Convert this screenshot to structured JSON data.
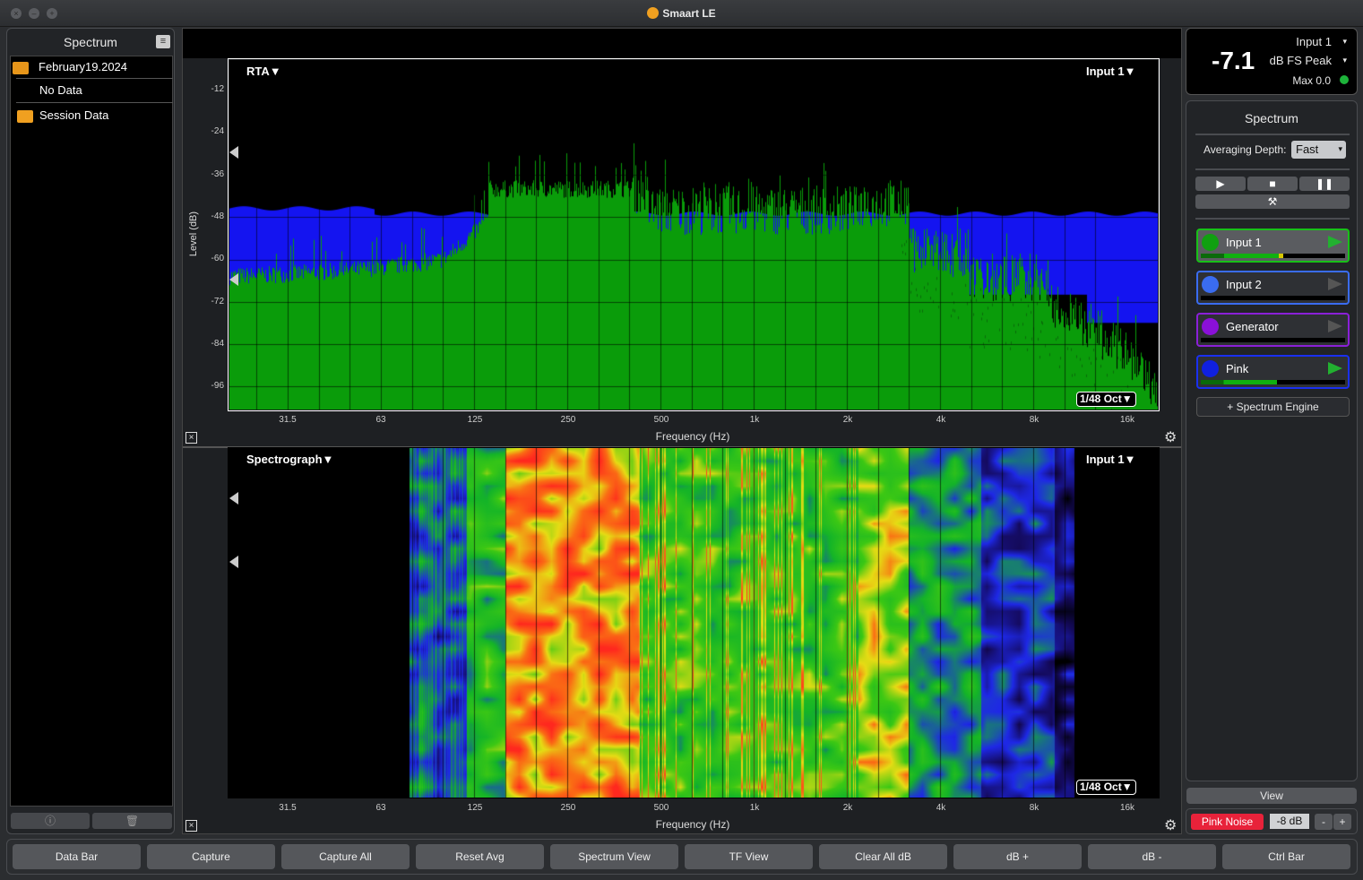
{
  "window": {
    "title": "Smaart LE"
  },
  "left_panel": {
    "title": "Spectrum",
    "items": [
      {
        "label": "February19.2024",
        "type": "folder-open"
      },
      {
        "label": "No Data",
        "type": "item"
      },
      {
        "label": "Session Data",
        "type": "folder"
      }
    ]
  },
  "rta": {
    "title": "RTA▼",
    "input": "Input 1▼",
    "resolution": "1/48 Oct▼",
    "ylabel": "Level (dB)",
    "xlabel": "Frequency (Hz)",
    "yticks": [
      "-12",
      "-24",
      "-36",
      "-48",
      "-60",
      "-72",
      "-84",
      "-96"
    ],
    "xticks": [
      "31.5",
      "63",
      "125",
      "250",
      "500",
      "1k",
      "2k",
      "4k",
      "8k",
      "16k"
    ]
  },
  "spectrograph": {
    "title": "Spectrograph▼",
    "input": "Input 1▼",
    "resolution": "1/48 Oct▼",
    "xlabel": "Frequency (Hz)",
    "xticks": [
      "31.5",
      "63",
      "125",
      "250",
      "500",
      "1k",
      "2k",
      "4k",
      "8k",
      "16k"
    ]
  },
  "meter": {
    "value": "-7.1",
    "source": "Input 1",
    "mode": "dB FS Peak",
    "max": "Max 0.0",
    "status_color": "#1db33a"
  },
  "spectrum_panel": {
    "title": "Spectrum",
    "averaging_label": "Averaging Depth:",
    "averaging_value": "Fast",
    "engines": [
      {
        "name": "Input 1",
        "color": "#10a010",
        "border": "#18c018",
        "active": true,
        "level": 0.72
      },
      {
        "name": "Input 2",
        "color": "#3a6cf0",
        "border": "#3a6cf0",
        "active": false,
        "level": 0
      },
      {
        "name": "Generator",
        "color": "#8a10d8",
        "border": "#8a20d8",
        "active": false,
        "level": 0
      },
      {
        "name": "Pink",
        "color": "#1020e0",
        "border": "#1a30f0",
        "active": true,
        "level": 0.7
      }
    ],
    "add_engine": "+ Spectrum Engine"
  },
  "view_button": "View",
  "generator": {
    "label": "Pink Noise",
    "level": "-8 dB",
    "minus": "-",
    "plus": "+",
    "color": "#e8223a"
  },
  "bottom_bar": [
    "Data Bar",
    "Capture",
    "Capture All",
    "Reset Avg",
    "Spectrum View",
    "TF View",
    "Clear All dB",
    "dB +",
    "dB -",
    "Ctrl Bar"
  ]
}
